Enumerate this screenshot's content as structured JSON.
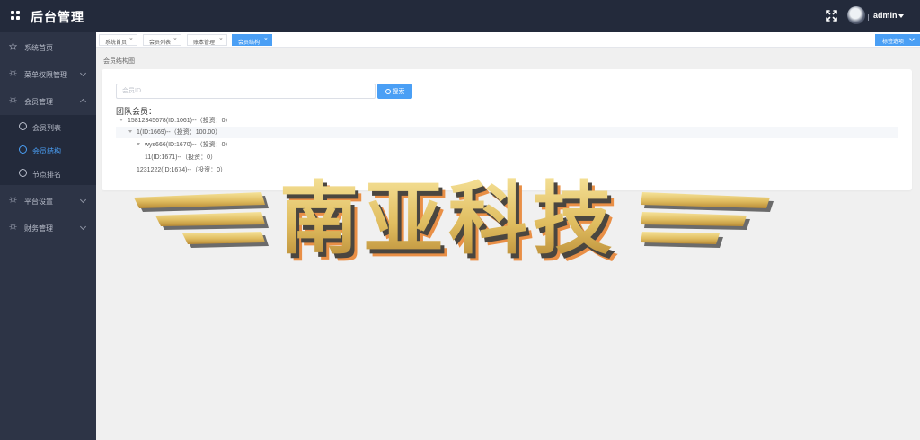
{
  "app": {
    "title": "后台管理"
  },
  "header": {
    "username": "admin"
  },
  "sidebar": {
    "items": [
      {
        "label": "系统首页"
      },
      {
        "label": "菜单权限管理"
      },
      {
        "label": "会员管理"
      },
      {
        "label": "平台设置"
      },
      {
        "label": "财务管理"
      }
    ],
    "member_sub": [
      {
        "label": "会员列表"
      },
      {
        "label": "会员结构"
      },
      {
        "label": "节点排名"
      }
    ]
  },
  "tabs": [
    {
      "label": "系统首页"
    },
    {
      "label": "会员列表"
    },
    {
      "label": "账本管理"
    },
    {
      "label": "会员结构"
    }
  ],
  "tab_close": "×",
  "tab_options": "标签选项",
  "breadcrumb": "会员结构图",
  "search": {
    "placeholder": "会员ID",
    "button": "搜索"
  },
  "team": {
    "label": "团队会员：",
    "rows": [
      {
        "text": "15812345678(ID:1061)--（投资：0）"
      },
      {
        "text": "1(ID:1669)--（投资：100.00）"
      },
      {
        "text": "wys666(ID:1670)--（投资：0）"
      },
      {
        "text": "11(ID:1671)--（投资：0）"
      },
      {
        "text": "1231222(ID:1674)--（投资：0）"
      }
    ]
  },
  "watermark": {
    "text": "南亚科技"
  },
  "colors": {
    "topbar": "#232a3b",
    "sidebar": "#2d3446",
    "accent": "#4a9ff5",
    "logo_gold": "#e8c66a",
    "logo_orange": "#e98f46"
  }
}
